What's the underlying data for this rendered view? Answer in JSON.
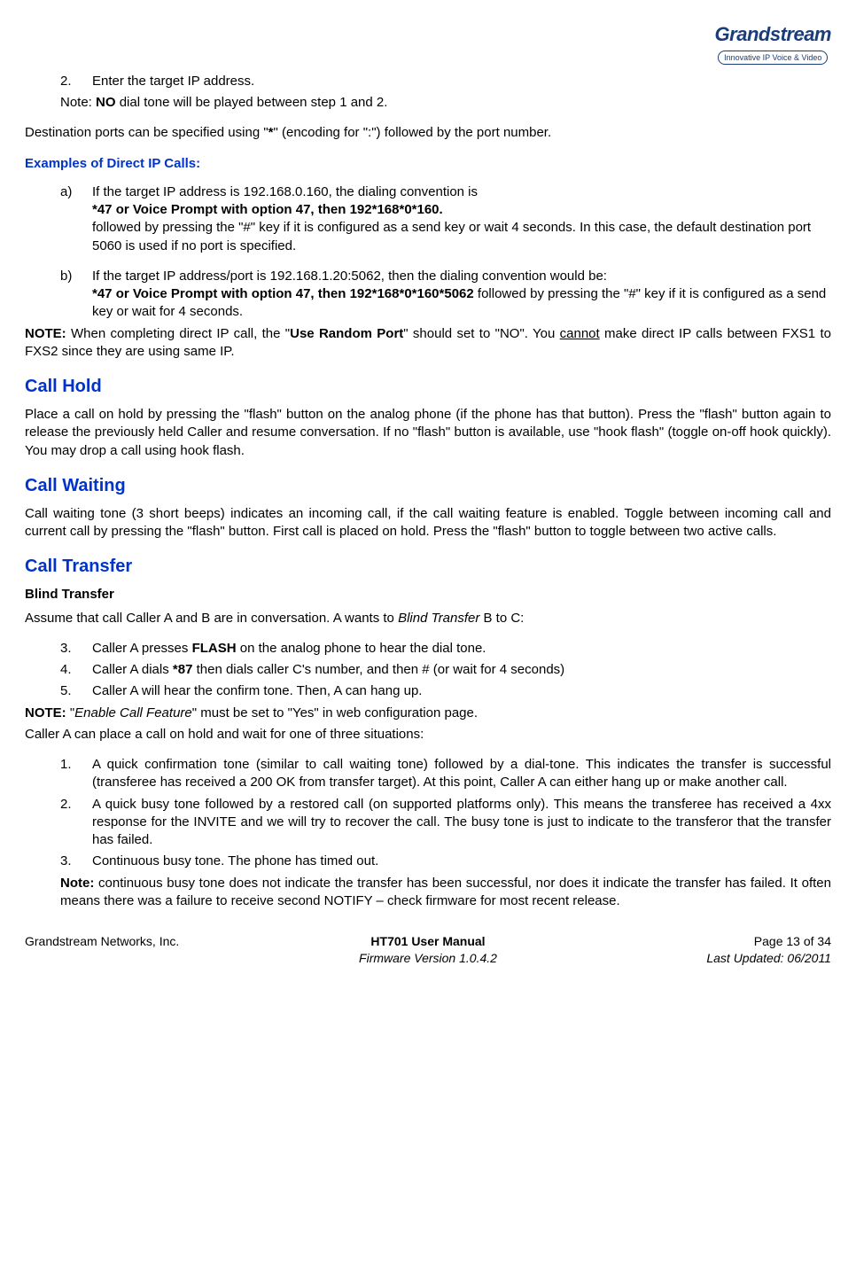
{
  "logo": {
    "main": "Grandstream",
    "sub": "Innovative IP Voice & Video"
  },
  "top": {
    "item2_marker": "2.",
    "item2_text": "Enter the target IP address.",
    "note_prefix": "Note: ",
    "note_bold": "NO",
    "note_rest": " dial tone will be played between step 1 and 2.",
    "dest_pre": "Destination ports can be specified using \"",
    "dest_star": "*",
    "dest_post": "\" (encoding for \":\") followed by the port number."
  },
  "examples": {
    "heading": "Examples of Direct IP Calls:",
    "a_marker": "a)",
    "a_line1": "If the target IP address is 192.168.0.160, the dialing convention is",
    "a_bold": "*47 or Voice Prompt with option 47, then 192*168*0*160.",
    "a_line2": "followed by pressing the \"#\" key if it is configured as a send key or wait 4 seconds. In this case, the default destination port 5060 is used if no port is specified.",
    "b_marker": "b)",
    "b_line1": "If the target IP address/port is 192.168.1.20:5062, then the dialing convention would be:",
    "b_bold": "*47 or Voice Prompt with option 47, then 192*168*0*160*5062",
    "b_rest": " followed by pressing the \"#\" key if it is configured as a send key or wait for 4 seconds."
  },
  "note1": {
    "label": "NOTE:",
    "pre": "  When completing direct IP call, the \"",
    "bold": "Use Random Port",
    "mid": "\" should set to \"NO\".   You ",
    "ul": "cannot",
    "post": " make direct IP calls between FXS1 to FXS2 since they are using same IP."
  },
  "hold": {
    "heading": "Call Hold",
    "body": "Place a call on hold by pressing the \"flash\" button on the analog phone (if the phone has that button). Press the \"flash\" button again to release the previously held Caller and resume conversation.   If no \"flash\" button is available, use \"hook flash\" (toggle on-off hook quickly). You may drop a call using hook flash."
  },
  "waiting": {
    "heading": "Call Waiting",
    "body": "Call waiting tone (3 short beeps) indicates an incoming call, if the call waiting feature is enabled. Toggle between incoming call and current call by pressing the \"flash\" button.   First call is placed on hold.   Press the \"flash\" button to toggle between two active calls."
  },
  "transfer": {
    "heading": "Call Transfer",
    "sub": "Blind Transfer",
    "intro_pre": "Assume that call Caller A and B are in conversation. A wants to ",
    "intro_em": "Blind Transfer",
    "intro_post": " B to C:",
    "s3_marker": "3.",
    "s3_pre": "Caller A presses ",
    "s3_bold": "FLASH",
    "s3_post": " on the analog phone to hear the dial tone.",
    "s4_marker": "4.",
    "s4_pre": "Caller A dials ",
    "s4_bold": "*87",
    "s4_post": " then dials caller C's number, and then # (or wait for 4 seconds)",
    "s5_marker": "5.",
    "s5_text": "Caller A will hear the confirm tone. Then, A can hang up."
  },
  "note2": {
    "label": "NOTE:",
    "pre": "    \"",
    "em": "Enable Call Feature",
    "post": "\" must be set to \"Yes\" in web configuration page.",
    "line2": "Caller A can place a call on hold and wait for one of three situations:"
  },
  "situations": {
    "s1_marker": "1.",
    "s1": "A quick confirmation tone (similar to call waiting tone) followed by a dial-tone.   This indicates the transfer is successful (transferee has received a 200 OK from transfer target).   At this point, Caller A can either hang up or make another call.",
    "s2_marker": "2.",
    "s2": "A quick busy tone followed by a restored call (on supported platforms only).  This means the transferee has received a 4xx response for the INVITE and we will try to recover the call.   The busy tone is just to indicate to the transferor that the transfer has failed.",
    "s3_marker": "3.",
    "s3": "Continuous busy tone.   The phone has timed out."
  },
  "note3": {
    "label": "Note:",
    "body": "  continuous busy tone does not indicate the transfer has been successful, nor does it indicate the transfer has failed.   It often means there was a failure to receive second NOTIFY – check firmware for most recent release."
  },
  "footer": {
    "left": "Grandstream Networks, Inc.",
    "mid1": "HT701 User Manual",
    "mid2": "Firmware Version 1.0.4.2",
    "right1": "Page 13 of 34",
    "right2": "Last Updated: 06/2011"
  }
}
